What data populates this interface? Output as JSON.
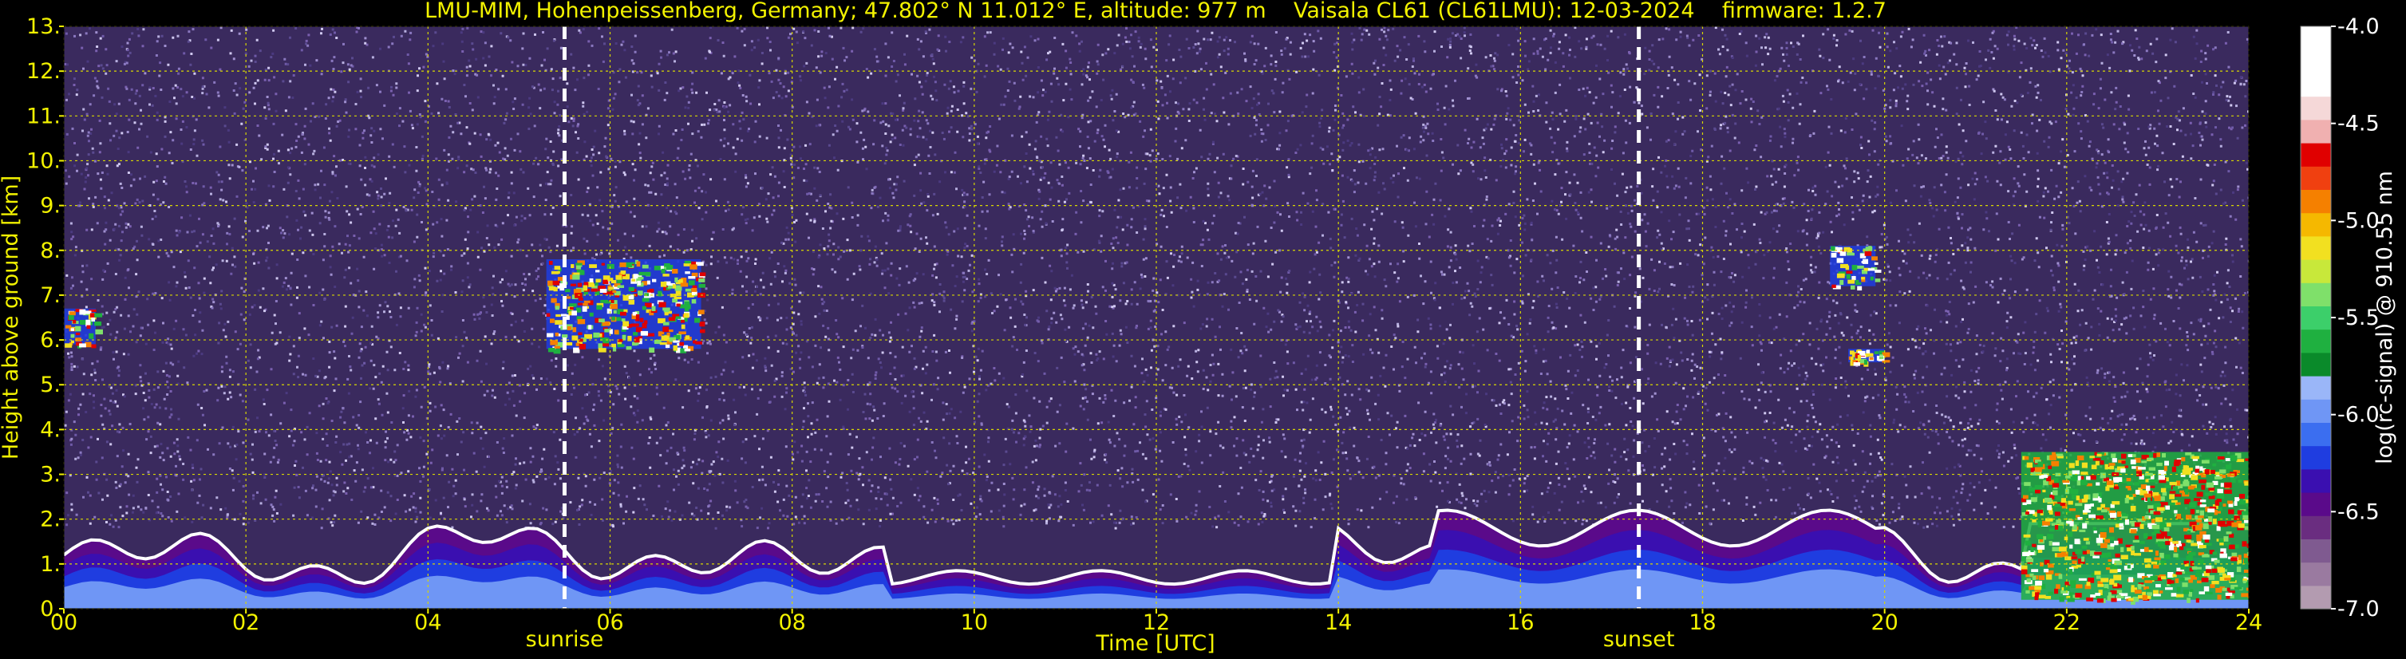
{
  "chart_data": {
    "type": "heatmap",
    "title": "LMU-MIM, Hohenpeissenberg, Germany; 47.802° N 11.012° E, altitude: 977 m    Vaisala CL61 (CL61LMU): 12-03-2024    firmware: 1.2.7",
    "xlabel": "Time [UTC]",
    "ylabel": "Height above ground [km]",
    "xlim": [
      0,
      24
    ],
    "ylim": [
      0,
      13
    ],
    "x_ticks": [
      "00",
      "02",
      "04",
      "06",
      "08",
      "10",
      "12",
      "14",
      "16",
      "18",
      "20",
      "22",
      "24"
    ],
    "y_ticks": [
      "0.",
      "1.",
      "2.",
      "3.",
      "4.",
      "5.",
      "6.",
      "7.",
      "8.",
      "9.",
      "10.",
      "11.",
      "12.",
      "13."
    ],
    "grid": true,
    "annotations": [
      {
        "label": "sunrise",
        "x": 5.5
      },
      {
        "label": "sunset",
        "x": 17.3
      }
    ],
    "colorbar": {
      "label": "log(rc-signal) @ 910.55 nm",
      "range": [
        -7.0,
        -4.0
      ],
      "ticks": [
        "-4.0",
        "-4.5",
        "-5.0",
        "-5.5",
        "-6.0",
        "-6.5",
        "-7.0"
      ],
      "tick_values": [
        -4.0,
        -4.5,
        -5.0,
        -5.5,
        -6.0,
        -6.5,
        -7.0
      ],
      "colors": [
        "#b39bb0",
        "#9a7aa0",
        "#7f5a90",
        "#6a2d80",
        "#5a0a8a",
        "#3a0fb0",
        "#1f3de0",
        "#3b6ef0",
        "#6f96f5",
        "#9ab6f8",
        "#0a8a2a",
        "#1fb040",
        "#3ccf6a",
        "#7fe06a",
        "#c8e83a",
        "#f2e020",
        "#f5b800",
        "#f58000",
        "#f04010",
        "#e00000",
        "#f0b0b0",
        "#f5d8d8",
        "#ffffff",
        "#ffffff",
        "#ffffff"
      ]
    },
    "features": [
      {
        "kind": "boundary-layer",
        "note": "strong backscatter below ~2 km throughout the day"
      },
      {
        "kind": "cloud",
        "x": [
          0.0,
          0.35
        ],
        "y": [
          5.9,
          6.7
        ]
      },
      {
        "kind": "cloud",
        "x": [
          5.3,
          7.0
        ],
        "y": [
          5.8,
          7.8
        ]
      },
      {
        "kind": "cloud",
        "x": [
          19.4,
          19.9
        ],
        "y": [
          7.2,
          8.1
        ]
      },
      {
        "kind": "cloud",
        "x": [
          19.6,
          20.0
        ],
        "y": [
          5.5,
          5.8
        ]
      },
      {
        "kind": "aerosol-layer",
        "x": [
          21.5,
          24.0
        ],
        "y": [
          0.2,
          3.5
        ]
      }
    ]
  }
}
